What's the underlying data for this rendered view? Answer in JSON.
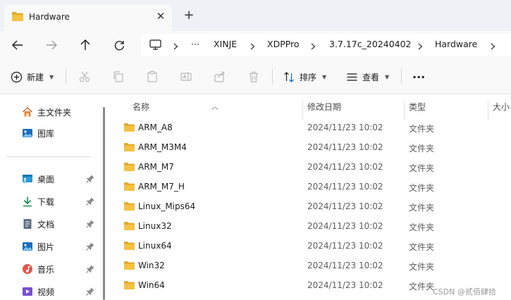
{
  "tab": {
    "title": "Hardware",
    "close_glyph": "✕",
    "new_tab_glyph": "+"
  },
  "breadcrumb": {
    "overflow": "···",
    "items": [
      "XINJE",
      "XDPPro",
      "3.7.17c_20240402",
      "Hardware"
    ]
  },
  "commands": {
    "new_label": "新建",
    "sort_label": "排序",
    "view_label": "查看",
    "more_glyph": "···"
  },
  "sidebar": {
    "top_items": [
      {
        "label": "主文件夹",
        "icon": "home-icon"
      },
      {
        "label": "图库",
        "icon": "gallery-icon"
      }
    ],
    "quick_items": [
      {
        "label": "桌面",
        "icon": "desktop-icon"
      },
      {
        "label": "下载",
        "icon": "download-icon"
      },
      {
        "label": "文档",
        "icon": "documents-icon"
      },
      {
        "label": "图片",
        "icon": "pictures-icon"
      },
      {
        "label": "音乐",
        "icon": "music-icon"
      },
      {
        "label": "视频",
        "icon": "videos-icon"
      }
    ]
  },
  "columns": {
    "name": "名称",
    "date": "修改日期",
    "type": "类型",
    "size": "大小"
  },
  "files": [
    {
      "name": "ARM_A8",
      "date": "2024/11/23 10:02",
      "type": "文件夹"
    },
    {
      "name": "ARM_M3M4",
      "date": "2024/11/23 10:02",
      "type": "文件夹"
    },
    {
      "name": "ARM_M7",
      "date": "2024/11/23 10:02",
      "type": "文件夹"
    },
    {
      "name": "ARM_M7_H",
      "date": "2024/11/23 10:02",
      "type": "文件夹"
    },
    {
      "name": "Linux_Mips64",
      "date": "2024/11/23 10:02",
      "type": "文件夹"
    },
    {
      "name": "Linux32",
      "date": "2024/11/23 10:02",
      "type": "文件夹"
    },
    {
      "name": "Linux64",
      "date": "2024/11/23 10:02",
      "type": "文件夹"
    },
    {
      "name": "Win32",
      "date": "2024/11/23 10:02",
      "type": "文件夹"
    },
    {
      "name": "Win64",
      "date": "2024/11/23 10:02",
      "type": "文件夹"
    }
  ],
  "watermark": "CSDN @贰佰肆拾",
  "colors": {
    "folder": "#f5c244",
    "folder_dark": "#e3a92a",
    "accent": "#0067c0"
  }
}
